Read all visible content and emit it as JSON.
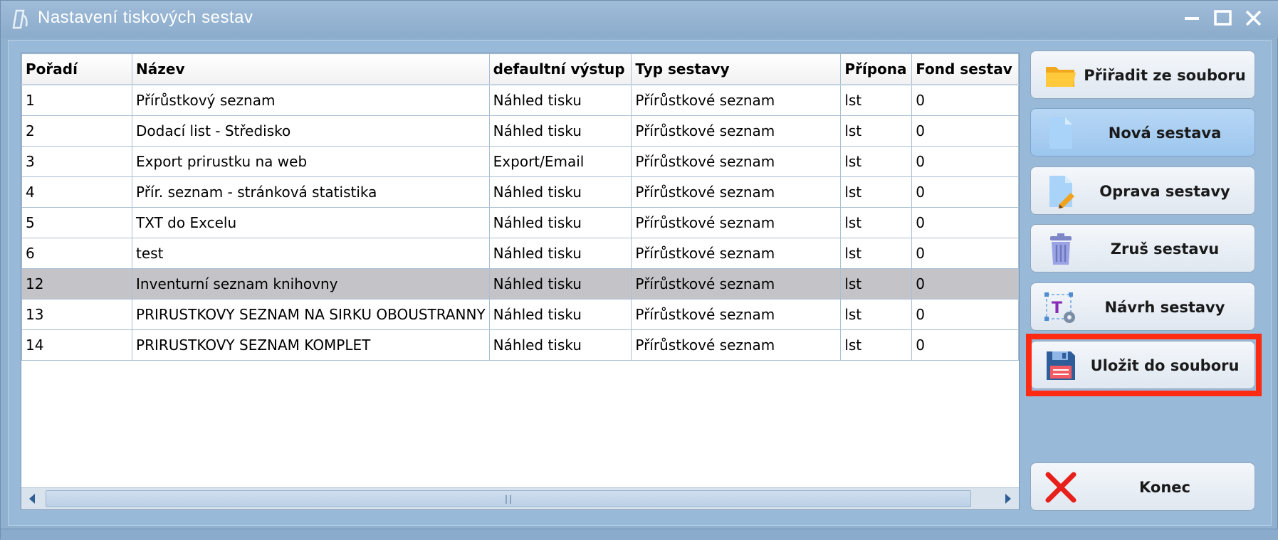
{
  "window": {
    "title": "Nastavení tiskových sestav"
  },
  "table": {
    "columns": [
      "Pořadí",
      "Název",
      "defaultní výstup",
      "Typ sestavy",
      "Přípona",
      "Fond sestav"
    ],
    "selected_row_index": 6,
    "rows": [
      [
        "1",
        "Přírůstkový seznam",
        "Náhled tisku",
        "Přírůstkové seznam",
        "lst",
        "0"
      ],
      [
        "2",
        "Dodací list - Středisko",
        "Náhled tisku",
        "Přírůstkové seznam",
        "lst",
        "0"
      ],
      [
        "3",
        "Export prirustku na web",
        "Export/Email",
        "Přírůstkové seznam",
        "lst",
        "0"
      ],
      [
        "4",
        "Přír. seznam - stránková statistika",
        "Náhled tisku",
        "Přírůstkové seznam",
        "lst",
        "0"
      ],
      [
        "5",
        "TXT do Excelu",
        "Náhled tisku",
        "Přírůstkové seznam",
        "lst",
        "0"
      ],
      [
        "6",
        "test",
        "Náhled tisku",
        "Přírůstkové seznam",
        "lst",
        "0"
      ],
      [
        "12",
        "Inventurní seznam knihovny",
        "Náhled tisku",
        "Přírůstkové seznam",
        "lst",
        "0"
      ],
      [
        "13",
        "PRIRUSTKOVY SEZNAM NA SIRKU OBOUSTRANNY",
        "Náhled tisku",
        "Přírůstkové seznam",
        "lst",
        "0"
      ],
      [
        "14",
        "PRIRUSTKOVY SEZNAM KOMPLET",
        "Náhled tisku",
        "Přírůstkové seznam",
        "lst",
        "0"
      ]
    ]
  },
  "buttons": {
    "assign_from_file": {
      "label": "Přiřadit ze souboru",
      "icon": "folder-icon"
    },
    "new_report": {
      "label": "Nová sestava",
      "icon": "document-icon"
    },
    "edit_report": {
      "label": "Oprava sestavy",
      "icon": "document-edit-icon"
    },
    "delete_report": {
      "label": "Zruš sestavu",
      "icon": "trash-icon"
    },
    "design_report": {
      "label": "Návrh sestavy",
      "icon": "report-designer-icon"
    },
    "save_to_file": {
      "label": "Uložit do souboru",
      "icon": "floppy-disk-icon"
    },
    "close": {
      "label": "Konec",
      "icon": "red-x-icon"
    }
  },
  "colors": {
    "selected_row": "#c4c4c8",
    "highlight_box": "#ff2a12",
    "active_button": "#a9cff2"
  }
}
